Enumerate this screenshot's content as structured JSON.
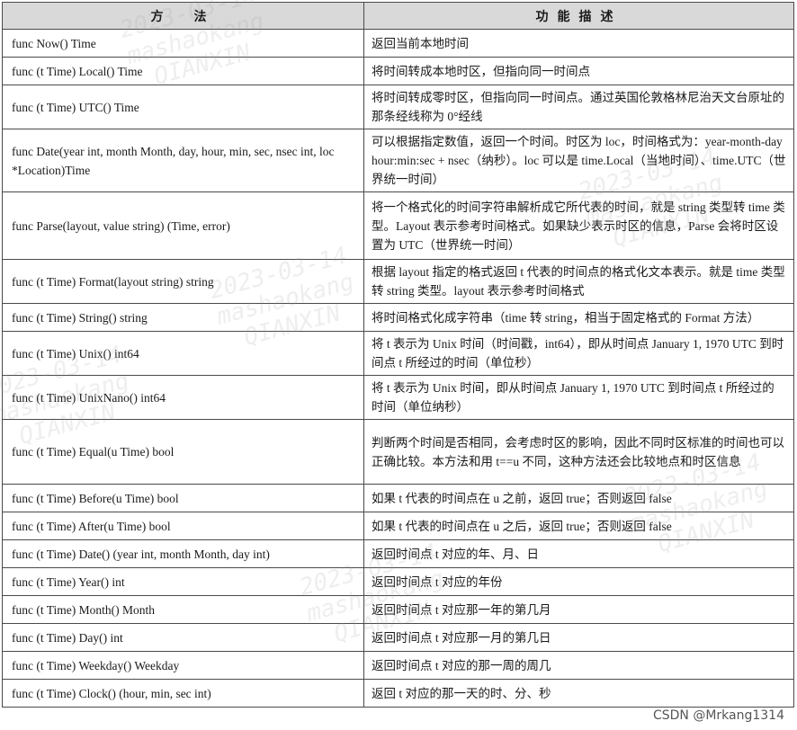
{
  "header": {
    "method": "方　法",
    "description": "功能描述"
  },
  "rows": [
    {
      "method": "func Now() Time",
      "description": "返回当前本地时间"
    },
    {
      "method": "func (t Time) Local() Time",
      "description": "将时间转成本地时区，但指向同一时间点"
    },
    {
      "method": "func (t Time) UTC() Time",
      "description": "将时间转成零时区，但指向同一时间点。通过英国伦敦格林尼治天文台原址的那条经线称为 0°经线"
    },
    {
      "method": "func Date(year int, month Month, day, hour, min, sec, nsec int, loc *Location)Time",
      "description": "可以根据指定数值，返回一个时间。时区为 loc，时间格式为：year-month-day hour:min:sec + nsec（纳秒）。loc 可以是 time.Local（当地时间）、time.UTC（世界统一时间）"
    },
    {
      "method": "func Parse(layout, value string) (Time, error)",
      "description": "将一个格式化的时间字符串解析成它所代表的时间，就是 string 类型转 time 类型。Layout 表示参考时间格式。如果缺少表示时区的信息，Parse 会将时区设置为 UTC（世界统一时间）"
    },
    {
      "method": "func (t Time) Format(layout string) string",
      "description": "根据 layout 指定的格式返回 t 代表的时间点的格式化文本表示。就是 time 类型转 string 类型。layout 表示参考时间格式"
    },
    {
      "method": "func (t Time) String() string",
      "description": "将时间格式化成字符串（time 转 string，相当于固定格式的 Format 方法）"
    },
    {
      "method": "func (t Time) Unix() int64",
      "description": "将 t 表示为 Unix 时间（时间戳，int64），即从时间点 January 1, 1970 UTC 到时间点 t 所经过的时间（单位秒）"
    },
    {
      "method": "func (t Time) UnixNano() int64",
      "description": "将 t 表示为 Unix 时间，即从时间点 January 1, 1970 UTC 到时间点 t 所经过的时间（单位纳秒）"
    },
    {
      "method": "func (t Time) Equal(u Time) bool",
      "description": "判断两个时间是否相同，会考虑时区的影响，因此不同时区标准的时间也可以正确比较。本方法和用 t==u 不同，这种方法还会比较地点和时区信息"
    },
    {
      "method": "func (t Time) Before(u Time) bool",
      "description": "如果 t 代表的时间点在 u 之前，返回 true；否则返回 false"
    },
    {
      "method": "func (t Time) After(u Time) bool",
      "description": "如果 t 代表的时间点在 u 之后，返回 true；否则返回 false"
    },
    {
      "method": "func (t Time) Date() (year int, month Month, day int)",
      "description": "返回时间点 t 对应的年、月、日"
    },
    {
      "method": "func (t Time) Year() int",
      "description": "返回时间点 t 对应的年份"
    },
    {
      "method": "func (t Time) Month() Month",
      "description": "返回时间点 t 对应那一年的第几月"
    },
    {
      "method": "func (t Time) Day() int",
      "description": "返回时间点 t 对应那一月的第几日"
    },
    {
      "method": "func (t Time) Weekday() Weekday",
      "description": "返回时间点 t 对应的那一周的周几"
    },
    {
      "method": "func (t Time) Clock() (hour, min, sec int)",
      "description": "返回 t 对应的那一天的时、分、秒"
    }
  ],
  "watermark": "2023-03-14\nmashaokang\nQIANXIN",
  "credit": "CSDN @Mrkang1314"
}
